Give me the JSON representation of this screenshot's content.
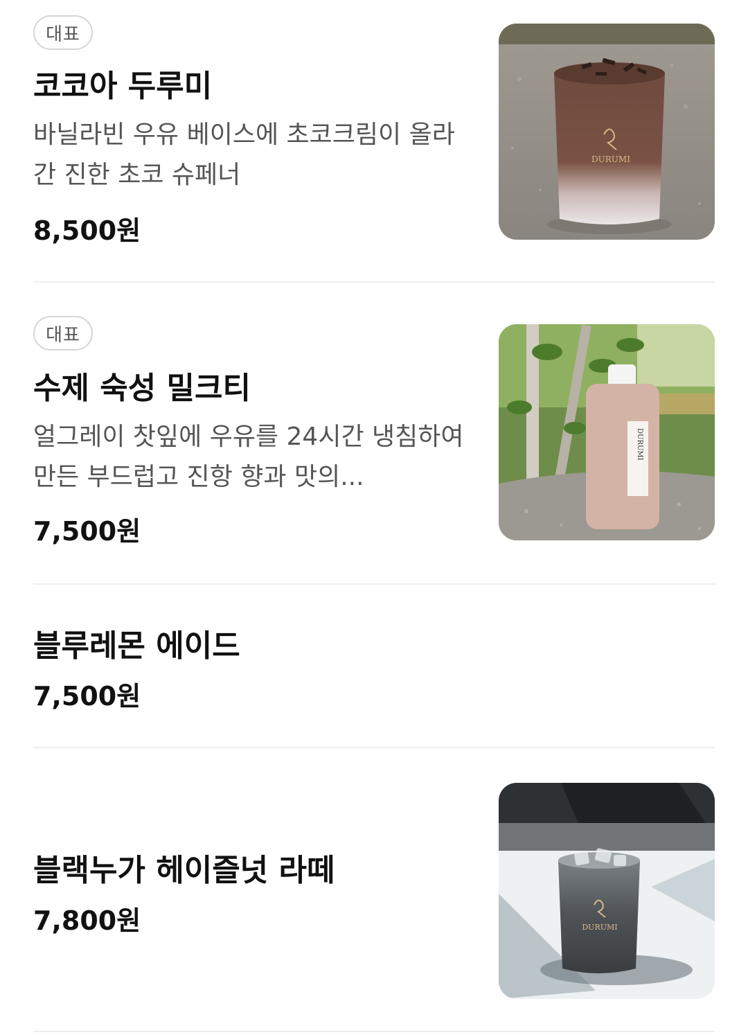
{
  "menu": {
    "items": [
      {
        "badge": "대표",
        "name": "코코아 두루미",
        "description": "바닐라빈 우유 베이스에 초코크림이 올라간 진한 초코 슈페너",
        "price": "8,500원",
        "image": "cocoa-durumi-photo",
        "brand_text": "DURUMI"
      },
      {
        "badge": "대표",
        "name": "수제 숙성 밀크티",
        "description": "얼그레이 찻잎에 우유를 24시간 냉침하여 만든 부드럽고 진항 향과 맛의...",
        "price": "7,500원",
        "image": "milk-tea-bottle-photo",
        "brand_text": "DURUMI"
      },
      {
        "name": "블루레몬 에이드",
        "price": "7,500원"
      },
      {
        "name": "블랙누가 헤이즐넛 라떼",
        "price": "7,800원",
        "image": "black-nougat-latte-photo",
        "brand_text": "DURUMI"
      }
    ]
  }
}
